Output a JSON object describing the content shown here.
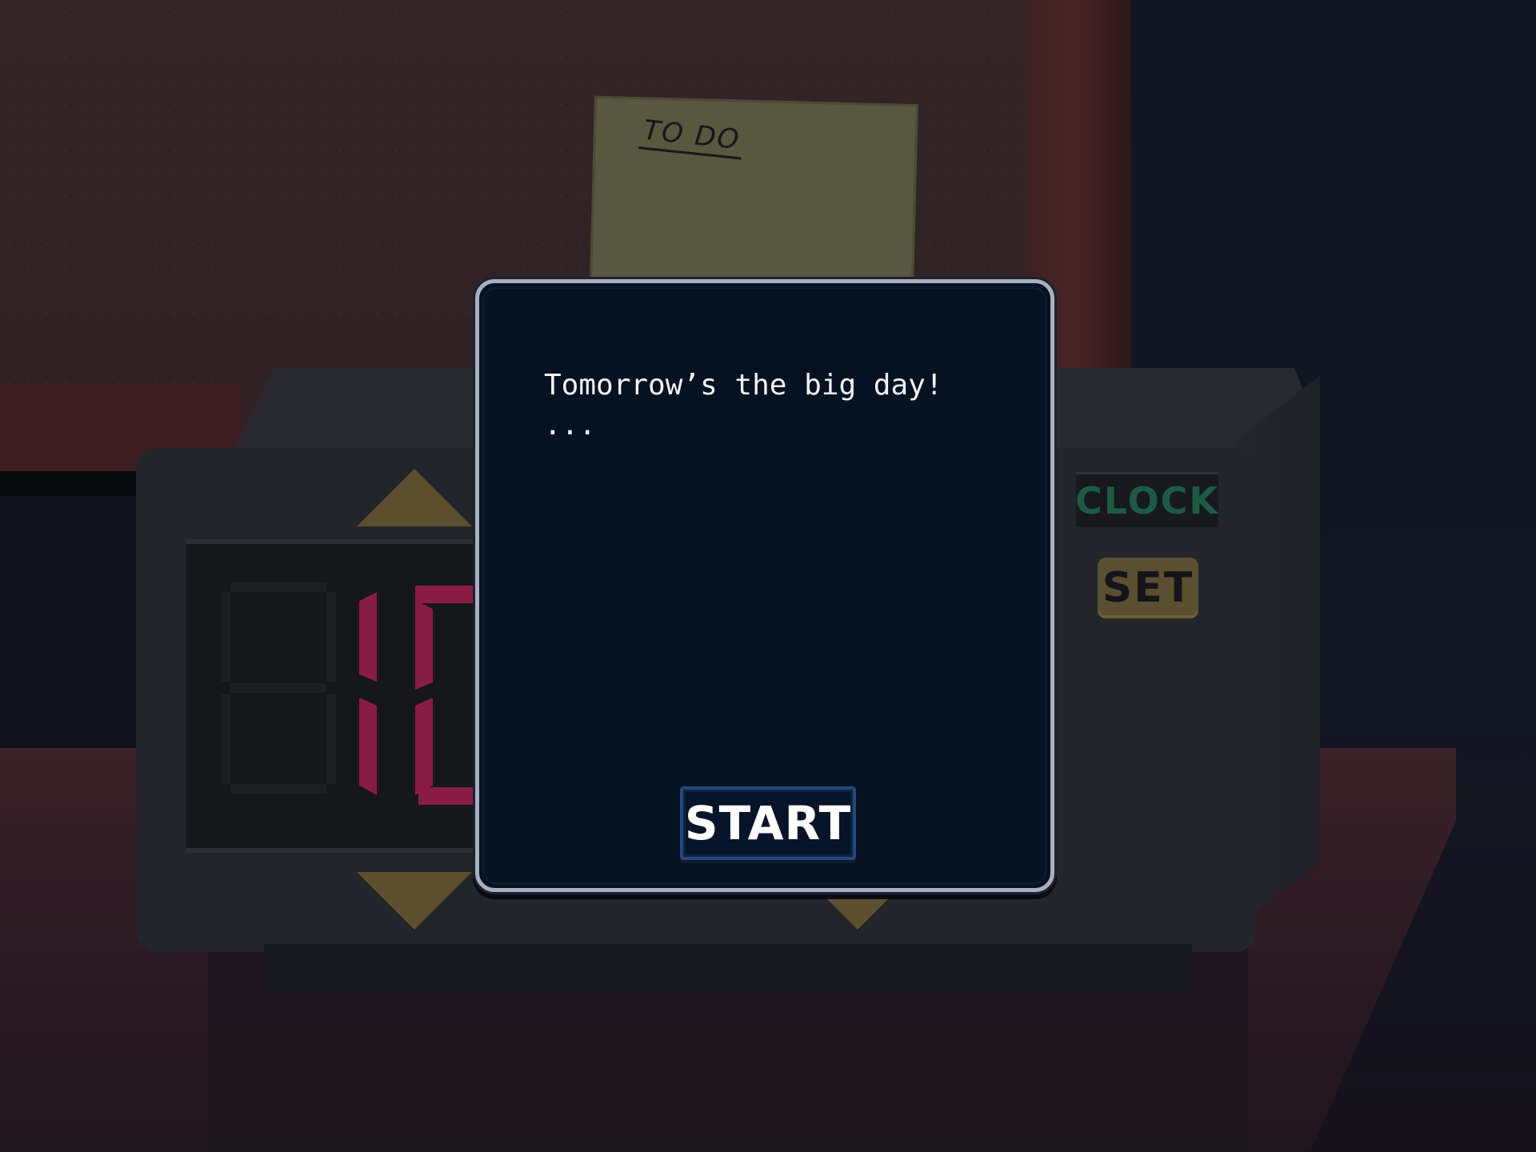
{
  "sticky_note": {
    "label": "TO DO"
  },
  "device": {
    "clock_label": "CLOCK",
    "set_label": "SET",
    "digit_color": "#8a1c44",
    "clock_label_color": "#1c5a44",
    "button_color": "#5a4f2e"
  },
  "dialog": {
    "line_1": "Tomorrow’s the big day!",
    "line_2": "...",
    "start_label": "START",
    "background_color": "#051222",
    "border_color": "#a8b0bb"
  }
}
